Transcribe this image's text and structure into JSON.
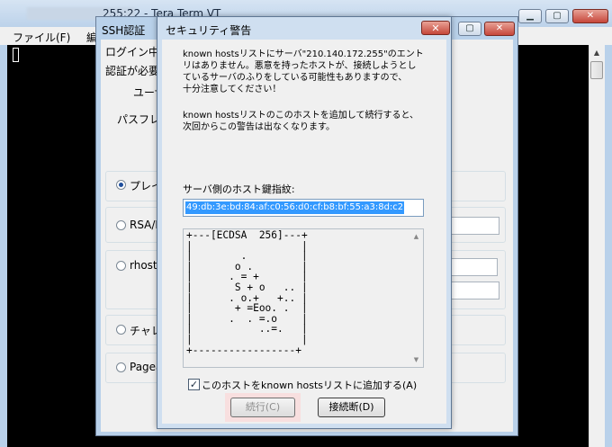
{
  "main_window": {
    "title": "255:22 - Tera Term VT",
    "menu": [
      "ファイル(F)",
      "編"
    ]
  },
  "ssh_window": {
    "title": "SSH認証",
    "login_label": "ログイン中:",
    "auth_required_label": "認証が必要",
    "username_label": "ユーザ",
    "passphrase_label": "パスフレ",
    "options": [
      {
        "label": "プレイン",
        "selected": true
      },
      {
        "label": "RSA/D",
        "selected": false
      },
      {
        "label": "rhosts",
        "selected": false
      },
      {
        "label": "チャレ",
        "selected": false
      },
      {
        "label": "Pagea",
        "selected": false
      }
    ]
  },
  "dialog": {
    "title": "セキュリティ警告",
    "close_label": "✕",
    "warning_lines": [
      "known hostsリストにサーバ\"210.140.172.255\"のエント",
      "リはありません。悪意を持ったホストが、接続しようとし",
      "ているサーバのふりをしている可能性もありますので、",
      "十分注意してください！"
    ],
    "add_info_lines": [
      "known hostsリストのこのホストを追加して続行すると、",
      "次回からこの警告は出なくなります。"
    ],
    "fingerprint_label": "サーバ側のホスト鍵指紋:",
    "fingerprint": "49:db:3e:bd:84:af:c0:56:d0:cf:b8:bf:55:a3:8d:c2",
    "randomart": "+---[ECDSA  256]---+\n|                  |\n|        .         |\n|       o .        |\n|      . = +       |\n|       S + o   .. |\n|      . o.+   +.. |\n|       + =Eoo. .  |\n|      .  . =.o    |\n|           ..=.   |\n|                  |\n+-----------------+",
    "checkbox_label": "このホストをknown hostsリストに追加する(A)",
    "checkbox_checked": true,
    "continue_label": "続行(C)",
    "disconnect_label": "接続断(D)"
  }
}
